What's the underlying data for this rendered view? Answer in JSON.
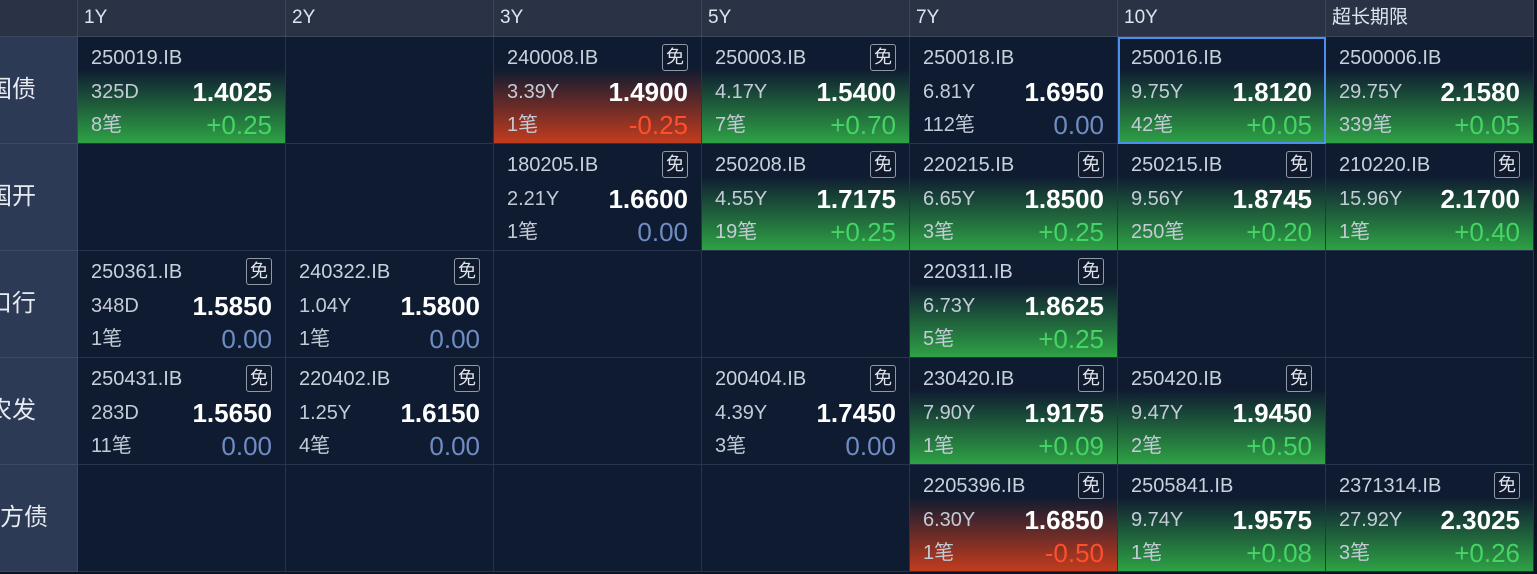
{
  "header": {
    "tenors": [
      "1Y",
      "2Y",
      "3Y",
      "5Y",
      "7Y",
      "10Y",
      "超长期限"
    ]
  },
  "rows": [
    {
      "label": "国债",
      "cells": [
        {
          "code": "250019.IB",
          "term": "325D",
          "yield": "1.4025",
          "trades": "8笔",
          "change": "+0.25"
        },
        null,
        {
          "code": "240008.IB",
          "badge": "免",
          "term": "3.39Y",
          "yield": "1.4900",
          "trades": "1笔",
          "change": "-0.25"
        },
        {
          "code": "250003.IB",
          "badge": "免",
          "term": "4.17Y",
          "yield": "1.5400",
          "trades": "7笔",
          "change": "+0.70"
        },
        {
          "code": "250018.IB",
          "term": "6.81Y",
          "yield": "1.6950",
          "trades": "112笔",
          "change": "0.00"
        },
        {
          "code": "250016.IB",
          "term": "9.75Y",
          "yield": "1.8120",
          "trades": "42笔",
          "change": "+0.05",
          "selected": true
        },
        {
          "code": "2500006.IB",
          "term": "29.75Y",
          "yield": "2.1580",
          "trades": "339笔",
          "change": "+0.05"
        }
      ]
    },
    {
      "label": "国开",
      "cells": [
        null,
        null,
        {
          "code": "180205.IB",
          "badge": "免",
          "term": "2.21Y",
          "yield": "1.6600",
          "trades": "1笔",
          "change": "0.00"
        },
        {
          "code": "250208.IB",
          "badge": "免",
          "term": "4.55Y",
          "yield": "1.7175",
          "trades": "19笔",
          "change": "+0.25"
        },
        {
          "code": "220215.IB",
          "badge": "免",
          "term": "6.65Y",
          "yield": "1.8500",
          "trades": "3笔",
          "change": "+0.25"
        },
        {
          "code": "250215.IB",
          "badge": "免",
          "term": "9.56Y",
          "yield": "1.8745",
          "trades": "250笔",
          "change": "+0.20"
        },
        {
          "code": "210220.IB",
          "badge": "免",
          "term": "15.96Y",
          "yield": "2.1700",
          "trades": "1笔",
          "change": "+0.40"
        }
      ]
    },
    {
      "label": "口行",
      "cells": [
        {
          "code": "250361.IB",
          "badge": "免",
          "term": "348D",
          "yield": "1.5850",
          "trades": "1笔",
          "change": "0.00"
        },
        {
          "code": "240322.IB",
          "badge": "免",
          "term": "1.04Y",
          "yield": "1.5800",
          "trades": "1笔",
          "change": "0.00"
        },
        null,
        null,
        {
          "code": "220311.IB",
          "badge": "免",
          "term": "6.73Y",
          "yield": "1.8625",
          "trades": "5笔",
          "change": "+0.25"
        },
        null,
        null
      ]
    },
    {
      "label": "农发",
      "cells": [
        {
          "code": "250431.IB",
          "badge": "免",
          "term": "283D",
          "yield": "1.5650",
          "trades": "11笔",
          "change": "0.00"
        },
        {
          "code": "220402.IB",
          "badge": "免",
          "term": "1.25Y",
          "yield": "1.6150",
          "trades": "4笔",
          "change": "0.00"
        },
        null,
        {
          "code": "200404.IB",
          "badge": "免",
          "term": "4.39Y",
          "yield": "1.7450",
          "trades": "3笔",
          "change": "0.00"
        },
        {
          "code": "230420.IB",
          "badge": "免",
          "term": "7.90Y",
          "yield": "1.9175",
          "trades": "1笔",
          "change": "+0.09"
        },
        {
          "code": "250420.IB",
          "badge": "免",
          "term": "9.47Y",
          "yield": "1.9450",
          "trades": "2笔",
          "change": "+0.50"
        },
        null
      ]
    },
    {
      "label": "方债",
      "cells": [
        null,
        null,
        null,
        null,
        {
          "code": "2205396.IB",
          "badge": "免",
          "term": "6.30Y",
          "yield": "1.6850",
          "trades": "1笔",
          "change": "-0.50"
        },
        {
          "code": "2505841.IB",
          "term": "9.74Y",
          "yield": "1.9575",
          "trades": "1笔",
          "change": "+0.08"
        },
        {
          "code": "2371314.IB",
          "badge": "免",
          "term": "27.92Y",
          "yield": "2.3025",
          "trades": "3笔",
          "change": "+0.26"
        }
      ]
    }
  ],
  "colors": {
    "up": "#45d564",
    "down": "#ff4f2c",
    "flat": "#6f8dc2",
    "up_fill": "#2ea245",
    "down_fill": "#c23c1e",
    "selected": "#4d8ff0"
  }
}
